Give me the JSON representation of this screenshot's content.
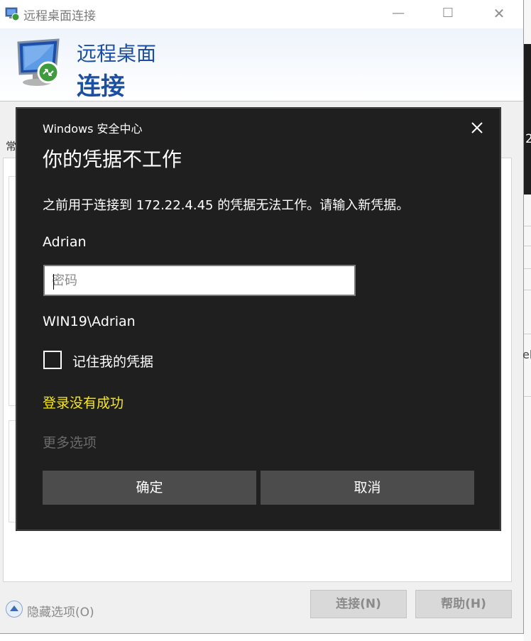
{
  "window": {
    "title": "远程桌面连接",
    "icon": "remote-desktop-icon",
    "controls": [
      "minimize-icon",
      "maximize-icon",
      "close-icon"
    ]
  },
  "banner": {
    "line1": "远程桌面",
    "line2": "连接",
    "accent": "#1a4fa3"
  },
  "tab_label": "常",
  "footer": {
    "hide_options": "隐藏选项(O)",
    "connect_button": "连接(N)",
    "help_button": "帮助(H)"
  },
  "right_edge": {
    "digit": "2",
    "fragment": "eb"
  },
  "dialog": {
    "title": "Windows 安全中心",
    "heading": "你的凭据不工作",
    "message": "之前用于连接到 172.22.4.45 的凭据无法工作。请输入新凭据。",
    "username": "Adrian",
    "password_placeholder": "密码",
    "password_value": "",
    "domain_user": "WIN19\\Adrian",
    "remember_label": "记住我的凭据",
    "remember_checked": false,
    "error_text": "登录没有成功",
    "error_color": "#f7e71c",
    "more_options": "更多选项",
    "ok_button": "确定",
    "cancel_button": "取消",
    "background": "#1f1f1f"
  }
}
